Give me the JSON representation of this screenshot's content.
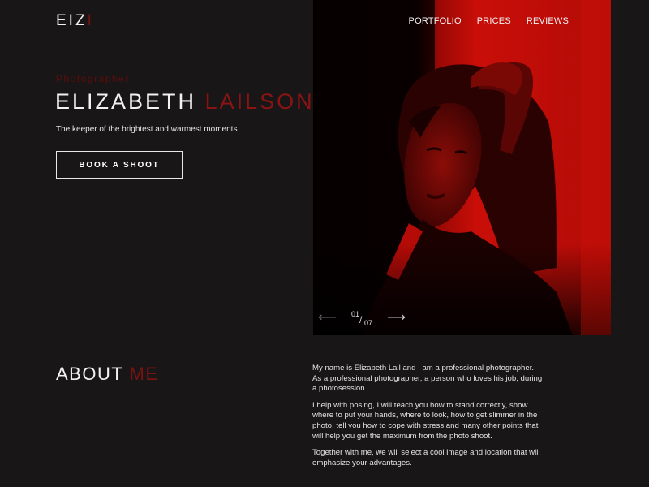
{
  "logo": {
    "main": "EIZ",
    "accent": "I"
  },
  "nav": {
    "items": [
      "PORTFOLIO",
      "PRICES",
      "REVIEWS"
    ]
  },
  "hero": {
    "role": "Photographer",
    "first_name": "ELIZABETH",
    "last_name": "LAILSON",
    "tagline": "The keeper of the brightest and warmest moments",
    "cta_label": "BOOK A SHOOT"
  },
  "slider": {
    "current": "01",
    "separator": "/",
    "total": "07",
    "prev_icon": "arrow-left-icon",
    "next_icon": "arrow-right-icon"
  },
  "about": {
    "title_main": "ABOUT",
    "title_accent": "ME",
    "paragraphs": [
      "My name is Elizabeth Lail and I am a professional photographer. As a professional photographer, a person who loves his job, during a photosession.",
      "I help with posing, I will teach you how to stand correctly, show where to put your hands, where to look, how to get slimmer in the photo, tell you how to cope with stress and many other points that will help you get the maximum from the photo shoot.",
      "Together with me, we will select a cool image and location that will emphasize your advantages."
    ]
  },
  "colors": {
    "background": "#181617",
    "accent_red": "#8c1313",
    "photo_red": "#c40d08"
  }
}
